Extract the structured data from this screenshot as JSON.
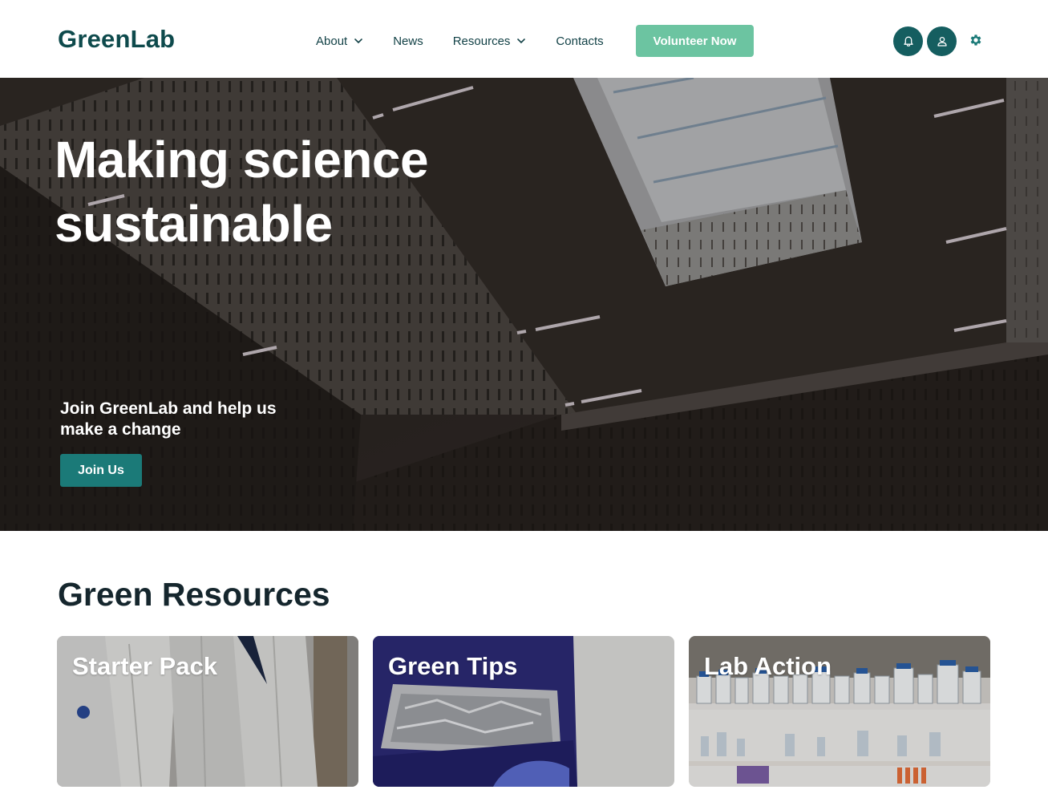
{
  "header": {
    "logo": "GreenLab",
    "nav": [
      {
        "label": "About",
        "has_dropdown": true
      },
      {
        "label": "News",
        "has_dropdown": false
      },
      {
        "label": "Resources",
        "has_dropdown": true
      },
      {
        "label": "Contacts",
        "has_dropdown": false
      }
    ],
    "cta_label": "Volunteer Now",
    "icons": [
      "bell-icon",
      "user-icon",
      "gear-icon"
    ]
  },
  "hero": {
    "title": "Making science sustainable",
    "subtitle": "Join GreenLab and help us make a change",
    "button_label": "Join Us"
  },
  "resources": {
    "heading": "Green Resources",
    "cards": [
      {
        "title": "Starter Pack"
      },
      {
        "title": "Green Tips"
      },
      {
        "title": "Lab Action"
      }
    ]
  },
  "colors": {
    "brand": "#0e4a4c",
    "accent": "#6cc4a1",
    "icon_bg": "#155e60",
    "join_button": "#1b7a78"
  }
}
